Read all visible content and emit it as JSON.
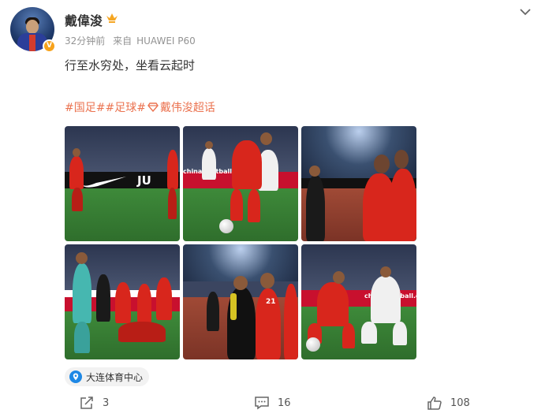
{
  "post": {
    "username": "戴偉浚",
    "time": "32分钟前",
    "source_prefix": "来自",
    "source_device": "HUAWEI P60",
    "content": "行至水穷处，坐看云起时",
    "tags": {
      "tag1": "#国足#",
      "tag2": "#足球#",
      "tag3": "戴伟浚超话"
    },
    "verified_badge": "V",
    "location": "大连体育中心"
  },
  "images": {
    "board_text_1": "JU",
    "board_text_2": "china football.com",
    "board_text_6": "china football.com",
    "jersey_number": "21"
  },
  "actions": {
    "share_count": "3",
    "comment_count": "16",
    "like_count": "108"
  },
  "icons": {
    "crown": "crown-icon",
    "more": "chevron-down-icon",
    "location": "location-pin-icon",
    "share": "share-icon",
    "comment": "comment-icon",
    "like": "thumbs-up-icon",
    "super_topic": "diamond-icon"
  },
  "colors": {
    "accent": "#eb7350",
    "meta_text": "#939393",
    "badge": "#f7a21b",
    "location_pin": "#1e88e5"
  }
}
